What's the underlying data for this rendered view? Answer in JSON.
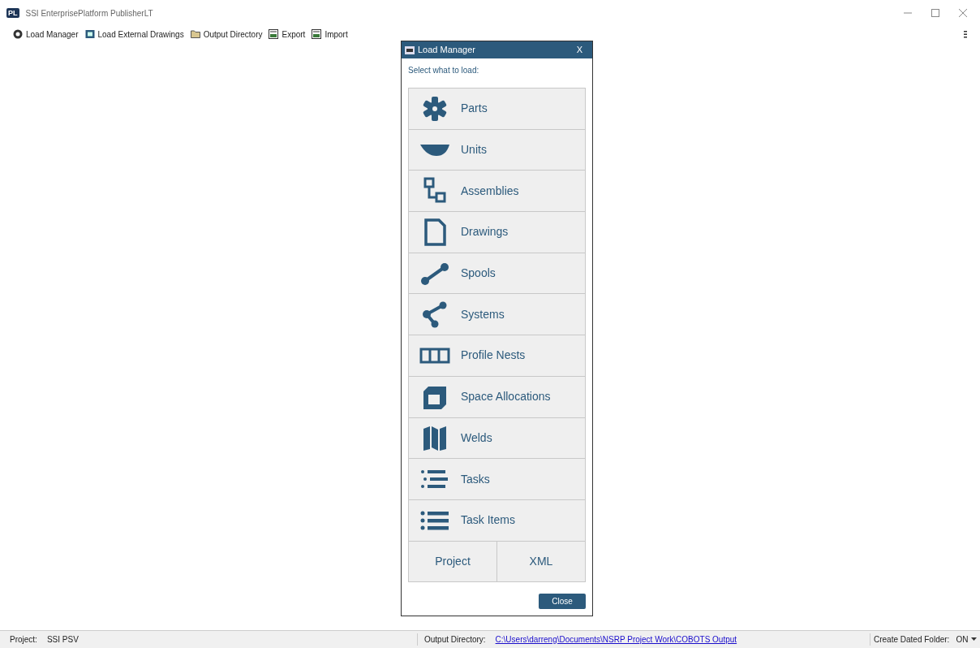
{
  "window": {
    "title": "SSI EnterprisePlatform PublisherLT",
    "logo": "PL"
  },
  "toolbar": [
    "Load Manager",
    "Load External Drawings",
    "Output Directory",
    "Export",
    "Import"
  ],
  "dialog": {
    "title": "Load Manager",
    "close_glyph": "X",
    "prompt": "Select what to load:",
    "items": [
      "Parts",
      "Units",
      "Assemblies",
      "Drawings",
      "Spools",
      "Systems",
      "Profile Nests",
      "Space Allocations",
      "Welds",
      "Tasks",
      "Task Items"
    ],
    "bottom_buttons": [
      "Project",
      "XML"
    ],
    "close_button": "Close"
  },
  "status_bar": {
    "project_label": "Project:",
    "project": "SSI PSV",
    "output_label": "Output Directory:",
    "output_path": "C:\\Users\\darreng\\Documents\\NSRP Project Work\\COBOTS Output",
    "dated_label": "Create Dated Folder:",
    "dated_value": "ON"
  }
}
